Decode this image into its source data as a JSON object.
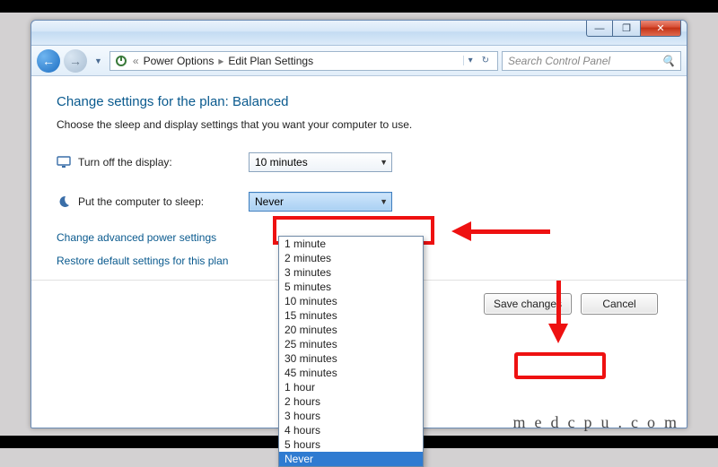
{
  "breadcrumb": {
    "item1": "Power Options",
    "item2": "Edit Plan Settings"
  },
  "search": {
    "placeholder": "Search Control Panel"
  },
  "page": {
    "heading": "Change settings for the plan: Balanced",
    "subtext": "Choose the sleep and display settings that you want your computer to use."
  },
  "rows": {
    "display": {
      "label": "Turn off the display:",
      "value": "10 minutes"
    },
    "sleep": {
      "label": "Put the computer to sleep:",
      "value": "Never"
    }
  },
  "links": {
    "advanced": "Change advanced power settings",
    "restore": "Restore default settings for this plan"
  },
  "buttons": {
    "save": "Save changes",
    "cancel": "Cancel"
  },
  "dropdown_options": [
    "1 minute",
    "2 minutes",
    "3 minutes",
    "5 minutes",
    "10 minutes",
    "15 minutes",
    "20 minutes",
    "25 minutes",
    "30 minutes",
    "45 minutes",
    "1 hour",
    "2 hours",
    "3 hours",
    "4 hours",
    "5 hours",
    "Never"
  ],
  "dropdown_selected": "Never",
  "watermark": "medcpu.com"
}
